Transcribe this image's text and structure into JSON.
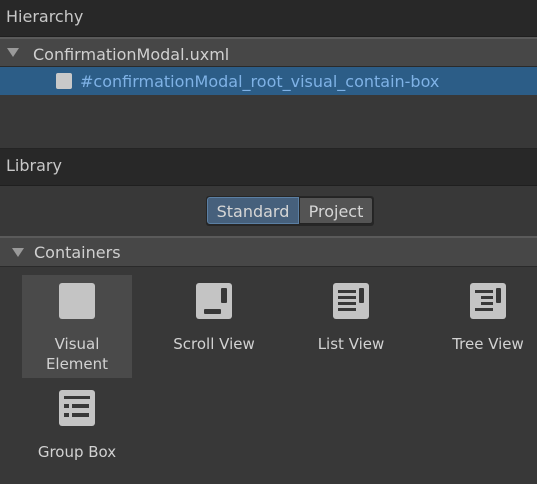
{
  "hierarchy": {
    "header": "Hierarchy",
    "file": "ConfirmationModal.uxml",
    "selected_item": "#confirmationModal_root_visual_contain-box"
  },
  "library": {
    "header": "Library",
    "tabs": {
      "standard": "Standard",
      "project": "Project",
      "active": "Standard"
    },
    "section": "Containers",
    "items": [
      {
        "label": "Visual\nElement",
        "icon": "visual-element-icon",
        "selected": true
      },
      {
        "label": "Scroll View",
        "icon": "scroll-view-icon",
        "selected": false
      },
      {
        "label": "List View",
        "icon": "list-view-icon",
        "selected": false
      },
      {
        "label": "Tree View",
        "icon": "tree-view-icon",
        "selected": false
      },
      {
        "label": "Group Box",
        "icon": "group-box-icon",
        "selected": false
      }
    ]
  },
  "colors": {
    "selection": "#2c5d87",
    "selected_text": "#7fb2e6",
    "active_tab": "#46607c"
  }
}
